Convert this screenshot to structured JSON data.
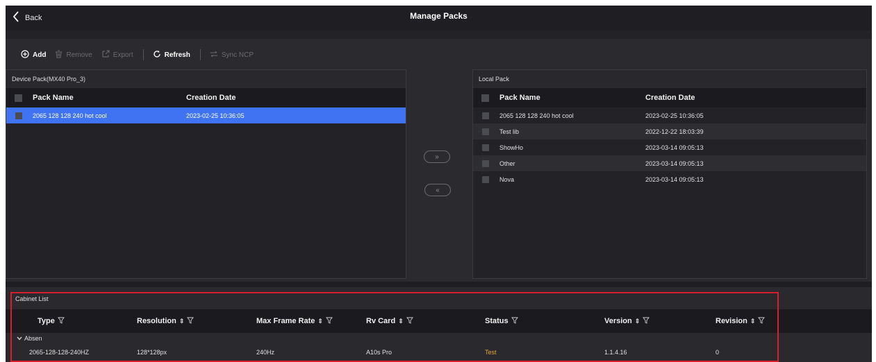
{
  "header": {
    "back_label": "Back",
    "title": "Manage Packs"
  },
  "toolbar": {
    "add": "Add",
    "remove": "Remove",
    "export": "Export",
    "refresh": "Refresh",
    "sync": "Sync NCP"
  },
  "device_pack": {
    "title": "Device Pack(MX40 Pro_3)",
    "columns": [
      "Pack Name",
      "Creation Date"
    ],
    "rows": [
      {
        "name": "2065 128 128 240 hot cool",
        "date": "2023-02-25 10:36:05"
      }
    ]
  },
  "local_pack": {
    "title": "Local Pack",
    "columns": [
      "Pack Name",
      "Creation Date"
    ],
    "rows": [
      {
        "name": "2065 128 128 240 hot cool",
        "date": "2023-02-25 10:36:05"
      },
      {
        "name": "Test lib",
        "date": "2022-12-22 18:03:39"
      },
      {
        "name": "ShowHo",
        "date": "2023-03-14 09:05:13"
      },
      {
        "name": "Other",
        "date": "2023-03-14 09:05:13"
      },
      {
        "name": "Nova",
        "date": "2023-03-14 09:05:13"
      }
    ]
  },
  "transfer": {
    "to_local": "»",
    "to_device": "«"
  },
  "cabinet_list": {
    "title": "Cabinet List",
    "columns": [
      "Type",
      "Resolution",
      "Max Frame Rate",
      "Rv Card",
      "Status",
      "Version",
      "Revision"
    ],
    "group": "Absen",
    "rows": [
      {
        "type": "2065-128-128-240HZ",
        "resolution": "128*128px",
        "frame_rate": "240Hz",
        "rv_card": "A10s Pro",
        "status": "Test",
        "version": "1.1.4.16",
        "revision": "0"
      }
    ]
  },
  "colors": {
    "selected_row": "#3f73f2",
    "status_test": "#e5a43c",
    "highlight_box": "#d81e2c"
  }
}
